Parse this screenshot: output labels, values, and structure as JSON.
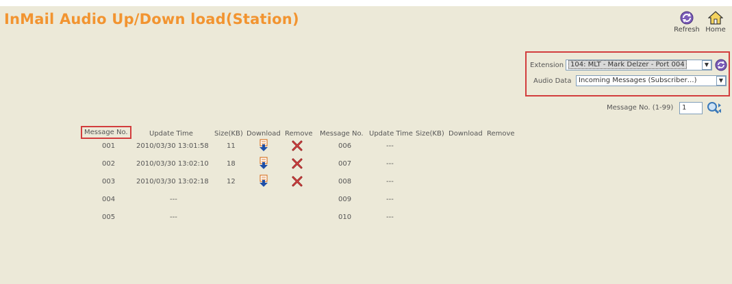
{
  "header": {
    "title": "InMail Audio Up/Down load(Station)",
    "refresh_label": "Refresh",
    "home_label": "Home"
  },
  "filters": {
    "extension_label": "Extension",
    "extension_value": "104: MLT - Mark Delzer - Port 004",
    "audio_label": "Audio Data",
    "audio_value": "Incoming Messages (Subscriber…)",
    "message_no_label": "Message No. (1-99)",
    "message_no_value": "1"
  },
  "table": {
    "headers_left": [
      "Message No.",
      "Update Time",
      "Size(KB)",
      "Download",
      "Remove"
    ],
    "headers_right": [
      "Message No.",
      "Update Time",
      "Size(KB)",
      "Download",
      "Remove"
    ],
    "left_rows": [
      {
        "no": "001",
        "time": "2010/03/30 13:01:58",
        "size": "11",
        "has_file": true
      },
      {
        "no": "002",
        "time": "2010/03/30 13:02:10",
        "size": "18",
        "has_file": true
      },
      {
        "no": "003",
        "time": "2010/03/30 13:02:18",
        "size": "12",
        "has_file": true
      },
      {
        "no": "004",
        "time": "---",
        "size": "",
        "has_file": false
      },
      {
        "no": "005",
        "time": "---",
        "size": "",
        "has_file": false
      }
    ],
    "right_rows": [
      {
        "no": "006",
        "time": "---"
      },
      {
        "no": "007",
        "time": "---"
      },
      {
        "no": "008",
        "time": "---"
      },
      {
        "no": "009",
        "time": "---"
      },
      {
        "no": "010",
        "time": "---"
      }
    ]
  },
  "colors": {
    "title": "#f29430",
    "highlight": "#d23c3c",
    "background": "#ece9d8"
  }
}
